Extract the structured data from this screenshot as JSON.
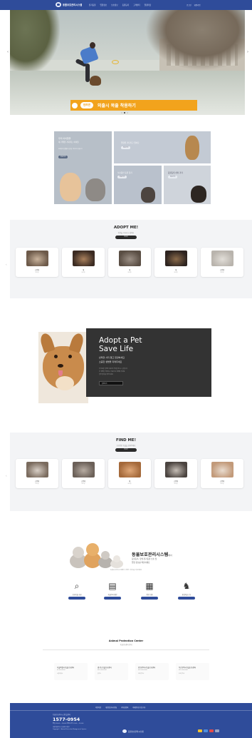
{
  "header": {
    "logo_text": "동물보호관리시스템",
    "nav": [
      "유기동물",
      "입양정보",
      "보호정보",
      "동물등록",
      "고객센터",
      "알림마당"
    ],
    "util": [
      "로그인",
      "회원가입"
    ]
  },
  "hero": {
    "banner_badge": "반려견",
    "banner_text": "외출시 목줄 착용하기",
    "dots": 3,
    "active_dot": 1,
    "colors": {
      "banner": "#f2a31c",
      "ring": "#e7b530"
    }
  },
  "grid": {
    "left_title": "우리 아이들을",
    "left_sub": "새 가족을 기다리는 아이들",
    "left_desc": "보호중인 동물들의 입양을 기다리고 있습니다",
    "left_button": "바로가기",
    "tr_label": "입양을 기다리고 있어요",
    "tr_button": "바로가기",
    "bm_label": "보호중인 동물 찾기",
    "bm_button": "바로가기",
    "br_label": "동물등록 하러 가기",
    "br_button": "바로가기"
  },
  "adopt": {
    "title": "ADOPT ME!",
    "subtitle": "입양을 기다리고 있어요",
    "button": "더보기",
    "cards": [
      {
        "name": "고양이",
        "sub": "보호중",
        "colors": [
          "#6d5a4a",
          "#c9b39c"
        ]
      },
      {
        "name": "개",
        "sub": "보호중",
        "colors": [
          "#3b2b22",
          "#a9805c"
        ]
      },
      {
        "name": "개",
        "sub": "보호중",
        "colors": [
          "#5a4e44",
          "#9b8f85"
        ]
      },
      {
        "name": "개",
        "sub": "보호중",
        "colors": [
          "#2e2420",
          "#8a6a4a"
        ]
      },
      {
        "name": "고양이",
        "sub": "보호중",
        "colors": [
          "#b9b4ad",
          "#e2ded8"
        ]
      }
    ]
  },
  "feature": {
    "title_line1": "Adopt a Pet",
    "title_line2": "Save Life",
    "kr_line1": "반려견 사지 말고 입양하세요",
    "kr_line2": "소중한 생명을 지켜주세요",
    "small_line1": "유기동물 입양은 새로운 가족을 만드는 일입니다",
    "small_line2": "한 생명을 책임지는 마음으로 함께해 주세요",
    "small_line3": "입양 절차를 확인하세요",
    "button": "입양하기"
  },
  "find": {
    "title": "FIND ME!",
    "subtitle": "보호중인 동물을 찾아주세요",
    "button": "더보기",
    "cards": [
      {
        "name": "고양이",
        "sub": "보호중",
        "colors": [
          "#7a6b5e",
          "#d8cfc6"
        ]
      },
      {
        "name": "고양이",
        "sub": "보호중",
        "colors": [
          "#6b6058",
          "#b7aca2"
        ]
      },
      {
        "name": "개",
        "sub": "보호중",
        "colors": [
          "#a4693a",
          "#e0a878"
        ]
      },
      {
        "name": "고양이",
        "sub": "보호중",
        "colors": [
          "#4b4440",
          "#c5bdb5"
        ]
      },
      {
        "name": "고양이",
        "sub": "보호중",
        "colors": [
          "#c29a7a",
          "#e9dccf"
        ]
      }
    ]
  },
  "system": {
    "title": "동물보호관리시스템",
    "title_suffix": "에서",
    "desc_line1": "동물등록, 유실·유기동물 보호 및",
    "desc_line2": "입양 정보를 확인하세요",
    "note": "동물보호관리시스템에서 다양한 서비스를 이용하세요",
    "services": [
      {
        "icon": "search-icon",
        "glyph": "⌕",
        "label": "보호동물 조회"
      },
      {
        "icon": "document-icon",
        "glyph": "▤",
        "label": "동물등록 확인"
      },
      {
        "icon": "form-icon",
        "glyph": "▦",
        "label": "입양 신청"
      },
      {
        "icon": "pet-icon",
        "glyph": "♞",
        "label": "유실동물 신고"
      }
    ]
  },
  "centers": {
    "title": "Animal Protection Center",
    "subtitle": "동물보호센터 안내",
    "items": [
      {
        "name": "서울특별시동물보호센터",
        "line1": "02-000-0000",
        "line2": "서울특별시"
      },
      {
        "name": "경기도동물보호센터",
        "line1": "031-000-0000",
        "line2": "경기도"
      },
      {
        "name": "인천광역시동물보호센터",
        "line1": "032-000-0000",
        "line2": "인천광역시"
      },
      {
        "name": "부산광역시동물보호센터",
        "line1": "051-000-0000",
        "line2": "부산광역시"
      }
    ]
  },
  "footer": {
    "links": [
      "이용약관",
      "개인정보처리방침",
      "저작권정책",
      "이메일무단수집거부"
    ],
    "org": "동물보호관리시스템 콜센터",
    "phone": "1577-0954",
    "hours": "평일 09:00 ~ 18:00 (점심시간 12:00 ~ 13:00)",
    "address": "세종특별자치시 농림축산식품부",
    "copyright": "Copyright © Animal Protection Management System",
    "logo_text": "동물보호관리시스템",
    "icon_colors": [
      "#f2c230",
      "#4d8fe0",
      "#e24a4a",
      "#9aa5c4"
    ]
  }
}
